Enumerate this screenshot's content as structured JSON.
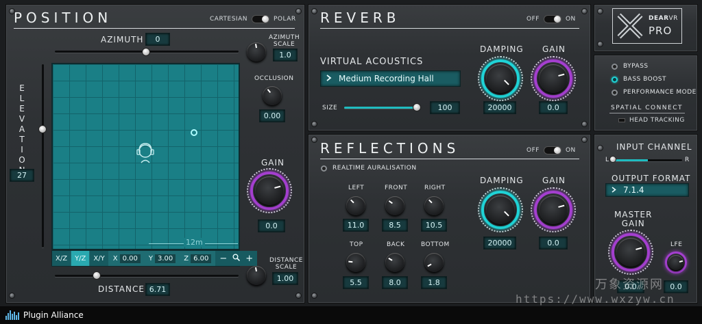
{
  "position": {
    "title": "POSITION",
    "mode_left": "CARTESIAN",
    "mode_right": "POLAR",
    "azimuth_label": "AZIMUTH",
    "azimuth_value": "0",
    "azimuth_scale_label_1": "AZIMUTH",
    "azimuth_scale_label_2": "SCALE",
    "azimuth_scale_value": "1.0",
    "occlusion_label": "OCCLUSION",
    "occlusion_value": "0.00",
    "elevation_label": "ELEVATION",
    "elevation_value": "27",
    "gain_label": "GAIN",
    "gain_value": "0.0",
    "distance_label": "DISTANCE",
    "distance_value": "6.71",
    "distance_scale_label_1": "DISTANCE",
    "distance_scale_label_2": "SCALE",
    "distance_scale_value": "1.00",
    "grid_scale": "12m",
    "views": [
      "X/Z",
      "Y/Z",
      "X/Y"
    ],
    "active_view": "Y/Z",
    "x_label": "X",
    "x_value": "0.00",
    "y_label": "Y",
    "y_value": "3.00",
    "z_label": "Z",
    "z_value": "6.00",
    "zoom_out": "−",
    "zoom_in": "+"
  },
  "reverb": {
    "title": "REVERB",
    "off": "OFF",
    "on": "ON",
    "virtual_acoustics_label": "VIRTUAL ACOUSTICS",
    "preset": "Medium Recording Hall",
    "size_label": "SIZE",
    "size_value": "100",
    "damping_label": "DAMPING",
    "damping_value": "20000",
    "gain_label": "GAIN",
    "gain_value": "0.0"
  },
  "reflections": {
    "title": "REFLECTIONS",
    "off": "OFF",
    "on": "ON",
    "realtime_label": "REALTIME AURALISATION",
    "left_label": "LEFT",
    "left_value": "11.0",
    "front_label": "FRONT",
    "front_value": "8.5",
    "right_label": "RIGHT",
    "right_value": "10.5",
    "top_label": "TOP",
    "top_value": "5.5",
    "back_label": "BACK",
    "back_value": "8.0",
    "bottom_label": "BOTTOM",
    "bottom_value": "1.8",
    "damping_label": "DAMPING",
    "damping_value": "20000",
    "gain_label": "GAIN",
    "gain_value": "0.0"
  },
  "side": {
    "logo_top": "DEAR",
    "logo_vr": "VR",
    "logo_pro": "PRO",
    "bypass": "BYPASS",
    "bass_boost": "BASS BOOST",
    "performance_mode": "PERFORMANCE MODE",
    "spatial_connect": "SPATIAL CONNECT",
    "head_tracking": "HEAD TRACKING",
    "input_channel": "INPUT CHANNEL",
    "input_l": "L",
    "input_r": "R",
    "output_format_label": "OUTPUT FORMAT",
    "output_format_value": "7.1.4",
    "master_gain_1": "MASTER",
    "master_gain_2": "GAIN",
    "master_gain_value": "0.0",
    "lfe_label": "LFE",
    "lfe_value": "0.0"
  },
  "footer": {
    "brand": "Plugin Alliance"
  },
  "watermark": {
    "cn": "万象资源网",
    "url": "https://www.wxzyw.cn"
  },
  "colors": {
    "teal": "#1fd3d6",
    "purple": "#a43fcf",
    "grid": "#1a7f86"
  }
}
